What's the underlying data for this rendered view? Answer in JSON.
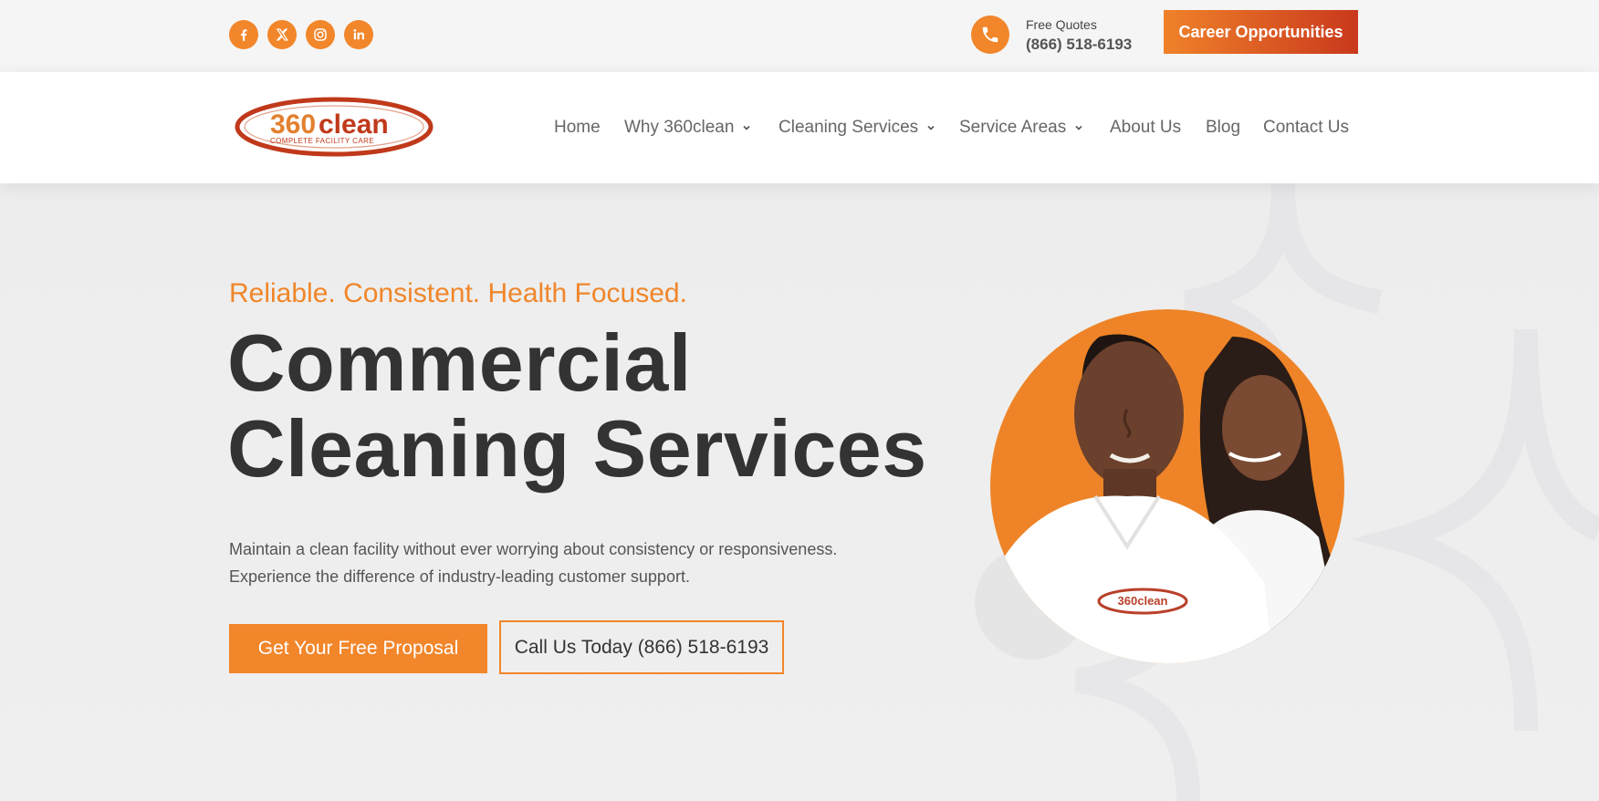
{
  "topbar": {
    "socials": [
      {
        "name": "facebook-icon",
        "glyph": "f"
      },
      {
        "name": "x-icon",
        "glyph": "X"
      },
      {
        "name": "instagram-icon",
        "glyph": "ig"
      },
      {
        "name": "linkedin-icon",
        "glyph": "in"
      }
    ],
    "phone_label": "Free Quotes",
    "phone_number": "(866) 518-6193",
    "career_button": "Career Opportunities"
  },
  "header": {
    "logo_text": "360clean",
    "logo_subtext": "COMPLETE FACILITY CARE",
    "nav": [
      {
        "label": "Home",
        "dropdown": false
      },
      {
        "label": "Why 360clean",
        "dropdown": true
      },
      {
        "label": "Cleaning Services",
        "dropdown": true
      },
      {
        "label": "Service Areas",
        "dropdown": true
      },
      {
        "label": "About Us",
        "dropdown": false
      },
      {
        "label": "Blog",
        "dropdown": false
      },
      {
        "label": "Contact Us",
        "dropdown": false
      }
    ]
  },
  "hero": {
    "tagline": "Reliable. Consistent. Health Focused.",
    "headline_line1": "Commercial",
    "headline_line2": "Cleaning Services",
    "desc_line1": "Maintain a clean facility without ever worrying about consistency or responsiveness.",
    "desc_line2": "Experience the difference of industry-leading customer support.",
    "primary_button": "Get Your Free Proposal",
    "secondary_button": "Call Us Today (866) 518-6193",
    "shirt_logo_text": "360clean"
  },
  "colors": {
    "accent": "#f2862a",
    "accent_dark": "#c9381c",
    "text_dark": "#333333",
    "logo_red": "#c0391b"
  }
}
